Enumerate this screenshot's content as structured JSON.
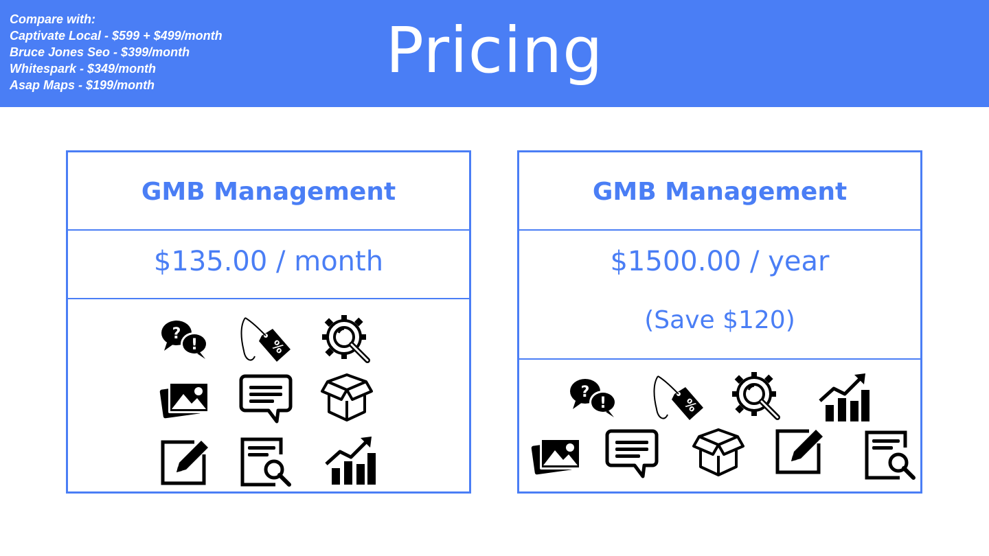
{
  "header": {
    "title": "Pricing",
    "compare": {
      "heading": "Compare with:",
      "lines": [
        "Captivate Local - $599 + $499/month",
        "Bruce Jones Seo - $399/month",
        "Whitespark - $349/month",
        "Asap Maps - $199/month"
      ]
    }
  },
  "plans": {
    "monthly": {
      "title": "GMB Management",
      "price": "$135.00 / month",
      "icons": [
        "qa-bubbles-icon",
        "price-tag-icon",
        "gear-search-icon",
        "photos-icon",
        "chat-bubble-icon",
        "box-icon",
        "edit-post-icon",
        "document-search-icon",
        "growth-chart-icon"
      ]
    },
    "yearly": {
      "title": "GMB Management",
      "price": "$1500.00 / year",
      "savings": "(Save $120)",
      "icons": [
        "qa-bubbles-icon",
        "price-tag-icon",
        "gear-search-icon",
        "growth-chart-icon",
        "photos-icon",
        "chat-bubble-icon",
        "box-icon",
        "edit-post-icon",
        "document-search-icon"
      ]
    }
  },
  "colors": {
    "accent": "#4a7ef5",
    "header_bg": "#4a7ef5",
    "icon": "#000000"
  }
}
